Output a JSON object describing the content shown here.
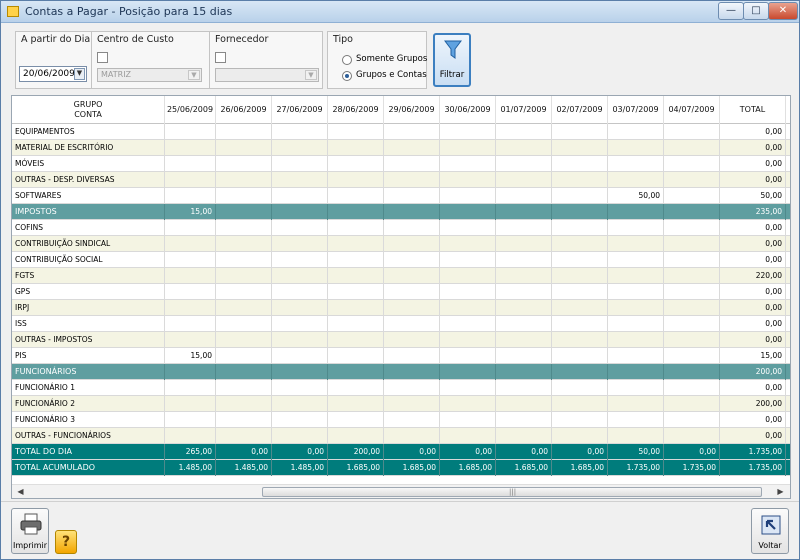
{
  "window": {
    "title": "Contas a Pagar - Posição para 15 dias"
  },
  "filters": {
    "date": {
      "label": "A partir do Dia",
      "value": "20/06/2009"
    },
    "cost_center": {
      "label": "Centro de Custo",
      "value": "MATRIZ"
    },
    "supplier": {
      "label": "Fornecedor",
      "value": ""
    },
    "type": {
      "label": "Tipo",
      "option1": "Somente Grupos",
      "option2": "Grupos e Contas",
      "selected": "Grupos e Contas"
    },
    "filter_button": "Filtrar"
  },
  "table": {
    "head_group": "GRUPO",
    "head_account": "CONTA",
    "date_cols": [
      "25/06/2009",
      "26/06/2009",
      "27/06/2009",
      "28/06/2009",
      "29/06/2009",
      "30/06/2009",
      "01/07/2009",
      "02/07/2009",
      "03/07/2009",
      "04/07/2009"
    ],
    "total_col": "TOTAL",
    "rows": [
      {
        "name": "EQUIPAMENTOS",
        "kind": "account",
        "vals": [
          "",
          "",
          "",
          "",
          "",
          "",
          "",
          "",
          "",
          ""
        ],
        "total": "0,00"
      },
      {
        "name": "MATERIAL DE ESCRITÓRIO",
        "kind": "account",
        "vals": [
          "",
          "",
          "",
          "",
          "",
          "",
          "",
          "",
          "",
          ""
        ],
        "total": "0,00"
      },
      {
        "name": "MÓVEIS",
        "kind": "account",
        "vals": [
          "",
          "",
          "",
          "",
          "",
          "",
          "",
          "",
          "",
          ""
        ],
        "total": "0,00"
      },
      {
        "name": "OUTRAS - DESP. DIVERSAS",
        "kind": "account",
        "vals": [
          "",
          "",
          "",
          "",
          "",
          "",
          "",
          "",
          "",
          ""
        ],
        "total": "0,00"
      },
      {
        "name": "SOFTWARES",
        "kind": "account",
        "vals": [
          "",
          "",
          "",
          "",
          "",
          "",
          "",
          "",
          "50,00",
          ""
        ],
        "total": "50,00"
      },
      {
        "name": "IMPOSTOS",
        "kind": "group",
        "vals": [
          "15,00",
          "",
          "",
          "",
          "",
          "",
          "",
          "",
          "",
          ""
        ],
        "total": "235,00"
      },
      {
        "name": "COFINS",
        "kind": "account",
        "vals": [
          "",
          "",
          "",
          "",
          "",
          "",
          "",
          "",
          "",
          ""
        ],
        "total": "0,00"
      },
      {
        "name": "CONTRIBUIÇÃO SINDICAL",
        "kind": "account",
        "vals": [
          "",
          "",
          "",
          "",
          "",
          "",
          "",
          "",
          "",
          ""
        ],
        "total": "0,00"
      },
      {
        "name": "CONTRIBUIÇÃO SOCIAL",
        "kind": "account",
        "vals": [
          "",
          "",
          "",
          "",
          "",
          "",
          "",
          "",
          "",
          ""
        ],
        "total": "0,00"
      },
      {
        "name": "FGTS",
        "kind": "account",
        "vals": [
          "",
          "",
          "",
          "",
          "",
          "",
          "",
          "",
          "",
          ""
        ],
        "total": "220,00"
      },
      {
        "name": "GPS",
        "kind": "account",
        "vals": [
          "",
          "",
          "",
          "",
          "",
          "",
          "",
          "",
          "",
          ""
        ],
        "total": "0,00"
      },
      {
        "name": "IRPJ",
        "kind": "account",
        "vals": [
          "",
          "",
          "",
          "",
          "",
          "",
          "",
          "",
          "",
          ""
        ],
        "total": "0,00"
      },
      {
        "name": "ISS",
        "kind": "account",
        "vals": [
          "",
          "",
          "",
          "",
          "",
          "",
          "",
          "",
          "",
          ""
        ],
        "total": "0,00"
      },
      {
        "name": "OUTRAS - IMPOSTOS",
        "kind": "account",
        "vals": [
          "",
          "",
          "",
          "",
          "",
          "",
          "",
          "",
          "",
          ""
        ],
        "total": "0,00"
      },
      {
        "name": "PIS",
        "kind": "account",
        "vals": [
          "15,00",
          "",
          "",
          "",
          "",
          "",
          "",
          "",
          "",
          ""
        ],
        "total": "15,00"
      },
      {
        "name": "FUNCIONÁRIOS",
        "kind": "group",
        "vals": [
          "",
          "",
          "",
          "",
          "",
          "",
          "",
          "",
          "",
          ""
        ],
        "total": "200,00"
      },
      {
        "name": "FUNCIONÁRIO 1",
        "kind": "account",
        "vals": [
          "",
          "",
          "",
          "",
          "",
          "",
          "",
          "",
          "",
          ""
        ],
        "total": "0,00"
      },
      {
        "name": "FUNCIONÁRIO 2",
        "kind": "account",
        "vals": [
          "",
          "",
          "",
          "",
          "",
          "",
          "",
          "",
          "",
          ""
        ],
        "total": "200,00"
      },
      {
        "name": "FUNCIONÁRIO 3",
        "kind": "account",
        "vals": [
          "",
          "",
          "",
          "",
          "",
          "",
          "",
          "",
          "",
          ""
        ],
        "total": "0,00"
      },
      {
        "name": "OUTRAS - FUNCIONÁRIOS",
        "kind": "account",
        "vals": [
          "",
          "",
          "",
          "",
          "",
          "",
          "",
          "",
          "",
          ""
        ],
        "total": "0,00"
      },
      {
        "name": "TOTAL DO DIA",
        "kind": "total",
        "vals": [
          "265,00",
          "0,00",
          "0,00",
          "200,00",
          "0,00",
          "0,00",
          "0,00",
          "0,00",
          "50,00",
          "0,00"
        ],
        "total": "1.735,00"
      },
      {
        "name": "TOTAL ACUMULADO",
        "kind": "total",
        "vals": [
          "1.485,00",
          "1.485,00",
          "1.485,00",
          "1.685,00",
          "1.685,00",
          "1.685,00",
          "1.685,00",
          "1.685,00",
          "1.735,00",
          "1.735,00"
        ],
        "total": "1.735,00"
      }
    ]
  },
  "buttons": {
    "print": "Imprimir",
    "back": "Voltar",
    "help": "?"
  },
  "colors": {
    "group_row": "#5f9ea0",
    "total_row": "#007c7c",
    "alt_row": "#f4f4e3"
  }
}
